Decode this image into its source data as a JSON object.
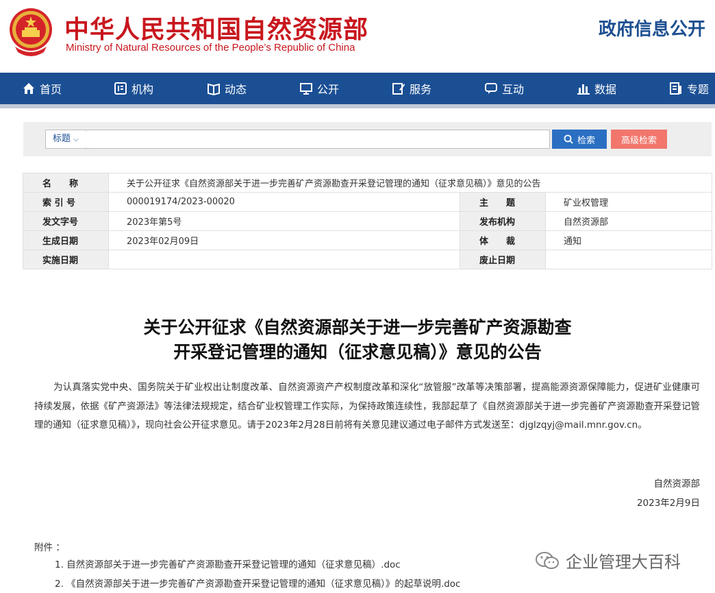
{
  "header": {
    "title": "中华人民共和国自然资源部",
    "subtitle": "Ministry of Natural Resources of the People’s Republic of China",
    "gov_info": "政府信息公开"
  },
  "nav": [
    {
      "label": "首页",
      "icon": "home-icon"
    },
    {
      "label": "机构",
      "icon": "org-icon"
    },
    {
      "label": "动态",
      "icon": "book-icon"
    },
    {
      "label": "公开",
      "icon": "monitor-icon"
    },
    {
      "label": "服务",
      "icon": "edit-icon"
    },
    {
      "label": "互动",
      "icon": "chat-icon"
    },
    {
      "label": "数据",
      "icon": "bar-chart-icon"
    },
    {
      "label": "专题",
      "icon": "topic-icon"
    }
  ],
  "search": {
    "type_label": "标题",
    "placeholder": "",
    "search_button": "检索",
    "advanced_button": "高级检索"
  },
  "meta": {
    "name_label": "名　　称",
    "name_value": "关于公开征求《自然资源部关于进一步完善矿产资源勘查开采登记管理的通知（征求意见稿）》意见的公告",
    "index_label": "索 引 号",
    "index_value": "000019174/2023-00020",
    "subject_label": "主　　题",
    "subject_value": "矿业权管理",
    "doc_no_label": "发文字号",
    "doc_no_value": "2023年第5号",
    "publisher_label": "发布机构",
    "publisher_value": "自然资源部",
    "created_label": "生成日期",
    "created_value": "2023年02月09日",
    "genre_label": "体　　裁",
    "genre_value": "通知",
    "effective_label": "实施日期",
    "effective_value": "",
    "expire_label": "废止日期",
    "expire_value": ""
  },
  "article": {
    "title_line1": "关于公开征求《自然资源部关于进一步完善矿产资源勘查",
    "title_line2": "开采登记管理的通知（征求意见稿）》意见的公告",
    "body": "为认真落实党中央、国务院关于矿业权出让制度改革、自然资源资产产权制度改革和深化“放管服”改革等决策部署，提高能源资源保障能力，促进矿业健康可持续发展，依据《矿产资源法》等法律法规规定，结合矿业权管理工作实际，为保持政策连续性，我部起草了《自然资源部关于进一步完善矿产资源勘查开采登记管理的通知（征求意见稿）》，现向社会公开征求意见。请于2023年2月28日前将有关意见建议通过电子邮件方式发送至：djglzqyj@mail.mnr.gov.cn。",
    "sign_org": "自然资源部",
    "sign_date": "2023年2月9日",
    "attachments_label": "附件 ：",
    "attachments": [
      "1. 自然资源部关于进一步完善矿产资源勘查开采登记管理的通知（征求意见稿）.doc",
      "2. 《自然资源部关于进一步完善矿产资源勘查开采登记管理的通知（征求意见稿）》的起草说明.doc"
    ]
  },
  "watermark": "企业管理大百科",
  "colors": {
    "brand_red": "#c8161d",
    "nav_blue": "#1b4f94",
    "search_blue": "#2b6fc3",
    "adv_red": "#f2766c"
  }
}
